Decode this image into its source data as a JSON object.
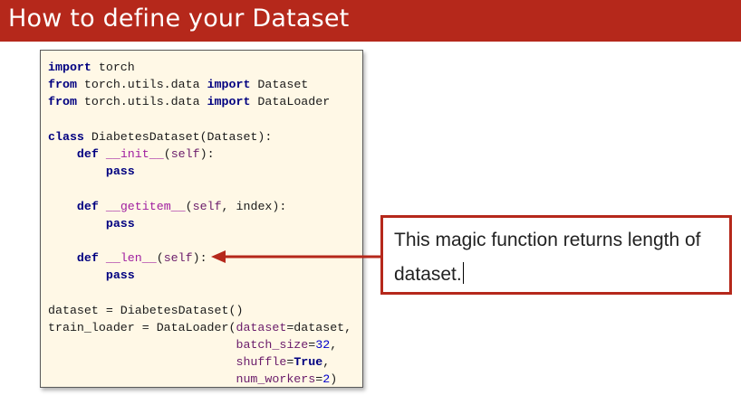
{
  "slide": {
    "title": "How to define your Dataset"
  },
  "code": {
    "l1_kw": "import",
    "l1_rest": " torch",
    "l2_kw1": "from",
    "l2_mid": " torch.utils.data ",
    "l2_kw2": "import",
    "l2_rest": " Dataset",
    "l3_kw1": "from",
    "l3_mid": " torch.utils.data ",
    "l3_kw2": "import",
    "l3_rest": " DataLoader",
    "l5_kw": "class",
    "l5_rest": " DiabetesDataset(Dataset):",
    "l6_kw": "def",
    "l6_fn": "__init__",
    "l6_open": "(",
    "l6_self": "self",
    "l6_close": "):",
    "l7_kw": "pass",
    "l9_kw": "def",
    "l9_fn": "__getitem__",
    "l9_open": "(",
    "l9_self": "self",
    "l9_rest": ", index):",
    "l10_kw": "pass",
    "l12_kw": "def",
    "l12_fn": "__len__",
    "l12_open": "(",
    "l12_self": "self",
    "l12_close": "):",
    "l13_kw": "pass",
    "l15": "dataset = DiabetesDataset()",
    "l16_a": "train_loader = DataLoader(",
    "l16_p": "dataset",
    "l16_b": "=dataset,",
    "l17_p": "batch_size",
    "l17_eq": "=",
    "l17_num": "32",
    "l17_end": ",",
    "l18_p": "shuffle",
    "l18_eq": "=",
    "l18_bold": "True",
    "l18_end": ",",
    "l19_p": "num_workers",
    "l19_eq": "=",
    "l19_num": "2",
    "l19_end": ")"
  },
  "callout": {
    "text": "This magic function returns length of dataset."
  },
  "colors": {
    "title_bar": "#b5281b",
    "callout_border": "#b5281b",
    "arrow": "#b5281b",
    "code_background": "#fff8e6"
  }
}
